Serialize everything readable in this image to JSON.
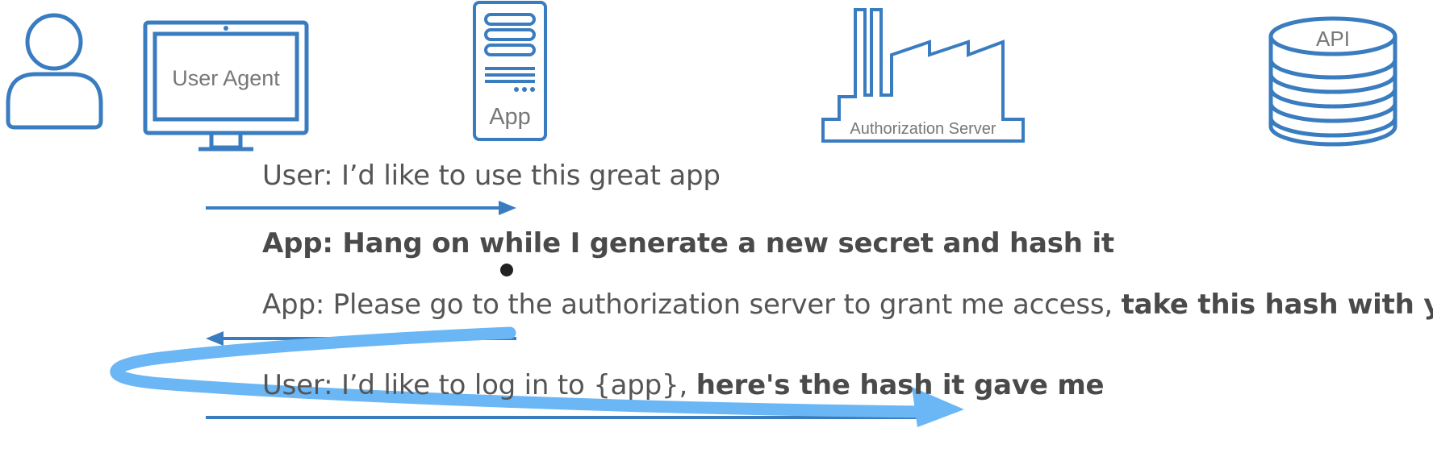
{
  "actors": {
    "user_agent_label": "User Agent",
    "app_label": "App",
    "auth_server_label": "Authorization Server",
    "api_label": "API"
  },
  "messages": {
    "m1": "User: I’d like to use this great app",
    "m2": "App: Hang on while I generate a new secret and hash it",
    "m3_normal": "App: Please go to the authorization server to grant me access,",
    "m3_bold": "take this hash with you",
    "m4_normal": "User: I’d like to log in to {app},",
    "m4_bold": "here's the hash it gave me"
  },
  "colors": {
    "icon_blue": "#3a7cc0",
    "arrow_blue": "#3a7cc0",
    "annotation_blue": "#6bb6f4",
    "text_gray": "#555555",
    "icon_label_gray": "#777777"
  },
  "icons": {
    "user": "user-person-icon",
    "user_agent": "monitor-icon",
    "app": "server-tower-icon",
    "auth_server": "factory-icon",
    "api": "database-stack-icon"
  }
}
